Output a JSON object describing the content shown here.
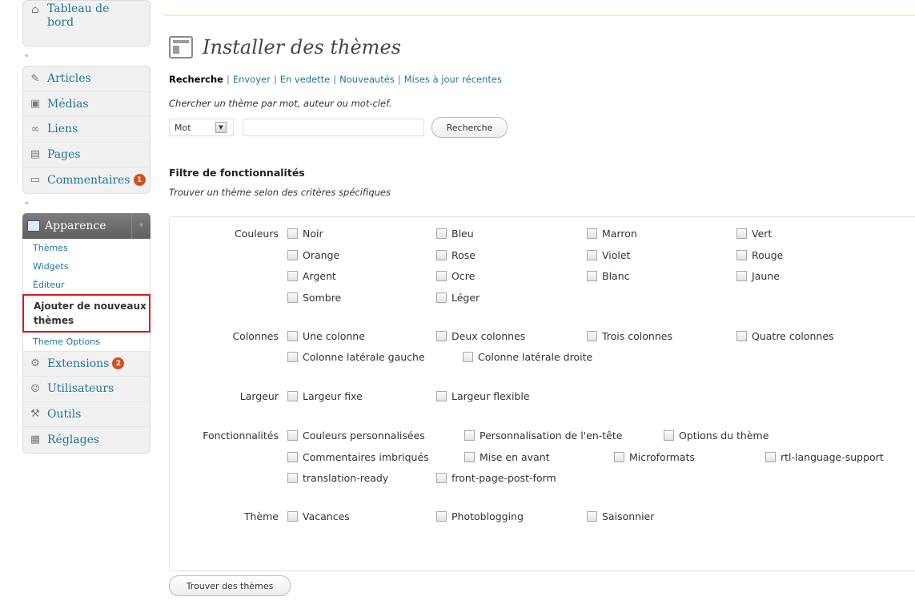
{
  "sidebar": {
    "dashboard": {
      "label": "Tableau de bord",
      "icon": "home-icon"
    },
    "items_group1": [
      {
        "label": "Articles",
        "icon": "pushpin-icon"
      },
      {
        "label": "Médias",
        "icon": "media-icon"
      },
      {
        "label": "Liens",
        "icon": "link-icon"
      },
      {
        "label": "Pages",
        "icon": "page-icon"
      },
      {
        "label": "Commentaires",
        "icon": "comment-icon",
        "badge": "1"
      }
    ],
    "appearance": {
      "label": "Apparence",
      "sub": [
        {
          "label": "Thèmes"
        },
        {
          "label": "Widgets"
        },
        {
          "label": "Éditeur"
        },
        {
          "label": "Ajouter de nouveaux thèmes",
          "current": true
        },
        {
          "label": "Theme Options"
        }
      ]
    },
    "items_group2": [
      {
        "label": "Extensions",
        "icon": "plugin-icon",
        "badge": "2"
      },
      {
        "label": "Utilisateurs",
        "icon": "users-icon"
      },
      {
        "label": "Outils",
        "icon": "tools-icon"
      },
      {
        "label": "Réglages",
        "icon": "settings-icon"
      }
    ]
  },
  "page": {
    "title": "Installer des thèmes",
    "tabs": [
      "Recherche",
      "Envoyer",
      "En vedette",
      "Nouveautés",
      "Mises à jour récentes"
    ],
    "search_hint": "Chercher un thème par mot, auteur ou mot-clef.",
    "search_type_selected": "Mot",
    "search_value": "",
    "search_button": "Recherche",
    "filter_title": "Filtre de fonctionnalités",
    "filter_hint": "Trouver un thème selon des critères spécifiques",
    "find_button": "Trouver des thèmes"
  },
  "filters": {
    "colors": {
      "label": "Couleurs",
      "options": [
        "Noir",
        "Bleu",
        "Marron",
        "Vert",
        "Orange",
        "Rose",
        "Violet",
        "Rouge",
        "Argent",
        "Ocre",
        "Blanc",
        "Jaune",
        "Sombre",
        "Léger"
      ]
    },
    "columns": {
      "label": "Colonnes",
      "options": [
        "Une colonne",
        "Deux colonnes",
        "Trois colonnes",
        "Quatre colonnes",
        "Colonne latérale gauche",
        "Colonne latérale droite"
      ]
    },
    "width": {
      "label": "Largeur",
      "options": [
        "Largeur fixe",
        "Largeur flexible"
      ]
    },
    "features": {
      "label": "Fonctionnalités",
      "options": [
        "Couleurs personnalisées",
        "Personnalisation de l'en-tête",
        "Options du thème",
        "Commentaires imbriqués",
        "Mise en avant",
        "Microformats",
        "rtl-language-support",
        "translation-ready",
        "front-page-post-form"
      ]
    },
    "subject": {
      "label": "Thème",
      "options": [
        "Vacances",
        "Photoblogging",
        "Saisonnier"
      ]
    }
  },
  "colors": {
    "link": "#21759b",
    "badge": "#d54e21",
    "highlight": "#e3141b"
  }
}
